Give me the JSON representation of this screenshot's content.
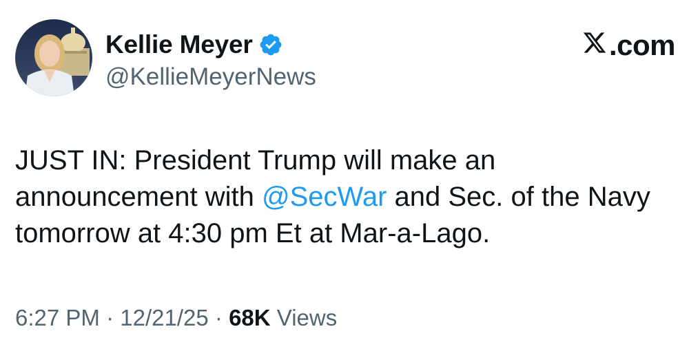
{
  "author": {
    "name": "Kellie Meyer",
    "handle": "@KellieMeyerNews",
    "verified": true,
    "badge_color": "#1d9bf0"
  },
  "brand": {
    "label": ".com",
    "logo_icon": "x-logo-icon"
  },
  "tweet": {
    "text_before": "JUST IN: President Trump will make an announcement with ",
    "mention": "@SecWar",
    "text_after": " and Sec. of the Navy tomorrow at 4:30 pm Et at Mar-a-Lago."
  },
  "meta": {
    "time": "6:27 PM",
    "separator": "·",
    "date": "12/21/25",
    "views_count": "68K",
    "views_label": "Views"
  },
  "colors": {
    "text": "#0f1419",
    "secondary": "#536471",
    "mention": "#1d9bf0"
  }
}
